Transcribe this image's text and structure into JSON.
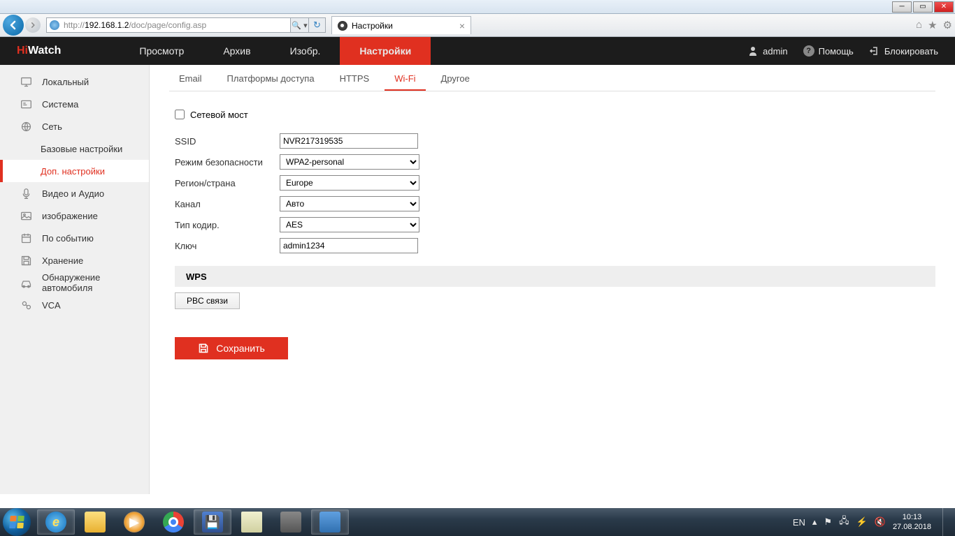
{
  "window": {
    "url_prefix": "http://",
    "url_host": "192.168.1.2",
    "url_path": "/doc/page/config.asp",
    "tab_title": "Настройки"
  },
  "header": {
    "logo_hi": "Hi",
    "logo_watch": "Watch",
    "nav": [
      "Просмотр",
      "Архив",
      "Изобр.",
      "Настройки"
    ],
    "user": "admin",
    "help": "Помощь",
    "lock": "Блокировать"
  },
  "sidebar": {
    "items": [
      "Локальный",
      "Система",
      "Сеть",
      "Базовые настройки",
      "Доп. настройки",
      "Видео и Аудио",
      "изображение",
      "По событию",
      "Хранение",
      "Обнаружение автомобиля",
      "VCA"
    ]
  },
  "subtabs": [
    "Email",
    "Платформы доступа",
    "HTTPS",
    "Wi-Fi",
    "Другое"
  ],
  "form": {
    "bridge_label": "Сетевой мост",
    "ssid_label": "SSID",
    "ssid_value": "NVR217319535",
    "security_label": "Режим безопасности",
    "security_value": "WPA2-personal",
    "region_label": "Регион/страна",
    "region_value": "Europe",
    "channel_label": "Канал",
    "channel_value": "Авто",
    "encrypt_label": "Тип кодир.",
    "encrypt_value": "AES",
    "key_label": "Ключ",
    "key_value": "admin1234",
    "wps_title": "WPS",
    "pbc_label": "PBC связи",
    "save_label": "Сохранить"
  },
  "tray": {
    "lang": "EN",
    "time": "10:13",
    "date": "27.08.2018"
  }
}
